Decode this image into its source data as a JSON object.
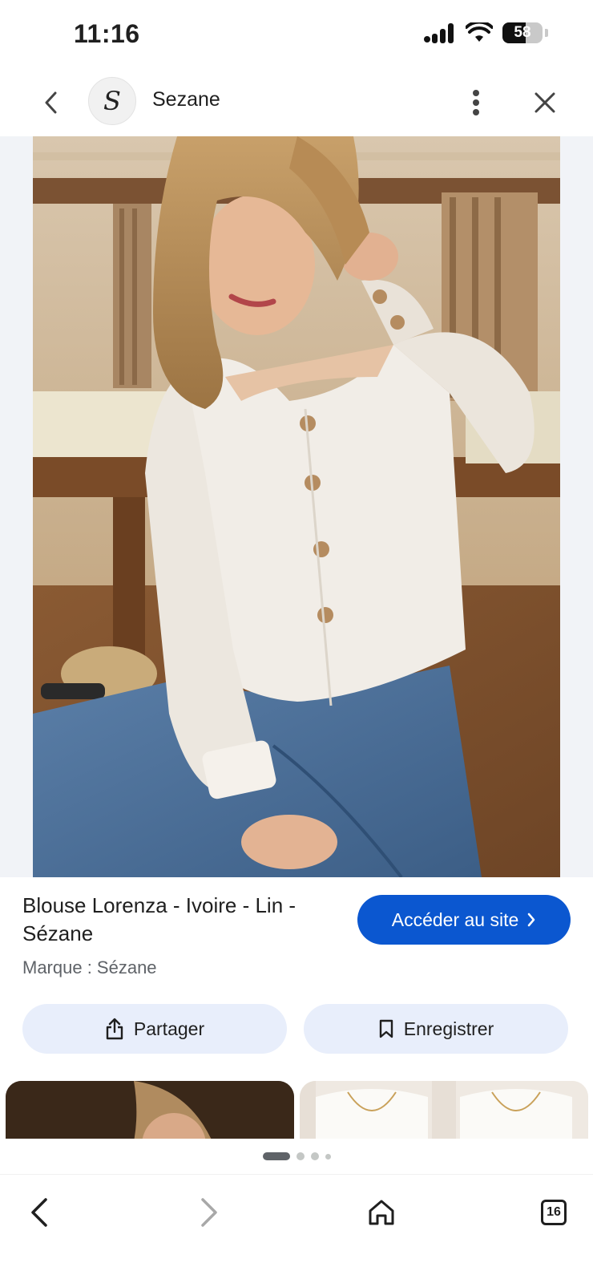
{
  "status_bar": {
    "time": "11:16",
    "battery_percent": 58,
    "battery_label": "58",
    "icons": [
      "cellular-signal-icon",
      "wifi-icon",
      "battery-icon"
    ]
  },
  "header": {
    "back_icon": "chevron-left-icon",
    "site_logo_letter": "S",
    "site_name": "Sezane",
    "more_icon": "more-vertical-icon",
    "close_icon": "close-icon"
  },
  "product": {
    "title": "Blouse Lorenza - Ivoire - Lin - Sézane",
    "brand": "Marque : Sézane",
    "visit_label": "Accéder au site",
    "visit_icon": "chevron-right-icon"
  },
  "actions": {
    "share_label": "Partager",
    "share_icon": "share-icon",
    "save_label": "Enregistrer",
    "save_icon": "bookmark-icon"
  },
  "pager": {
    "count": 4,
    "active_index": 0
  },
  "bottom_nav": {
    "back_icon": "back-arrow-icon",
    "forward_icon": "forward-arrow-icon",
    "home_icon": "home-icon",
    "tabs_icon": "tabs-icon",
    "tabs_count": "16"
  },
  "colors": {
    "accent": "#0b57d0",
    "tonal_button": "#e8eefb",
    "stage_background": "#f1f3f7"
  }
}
